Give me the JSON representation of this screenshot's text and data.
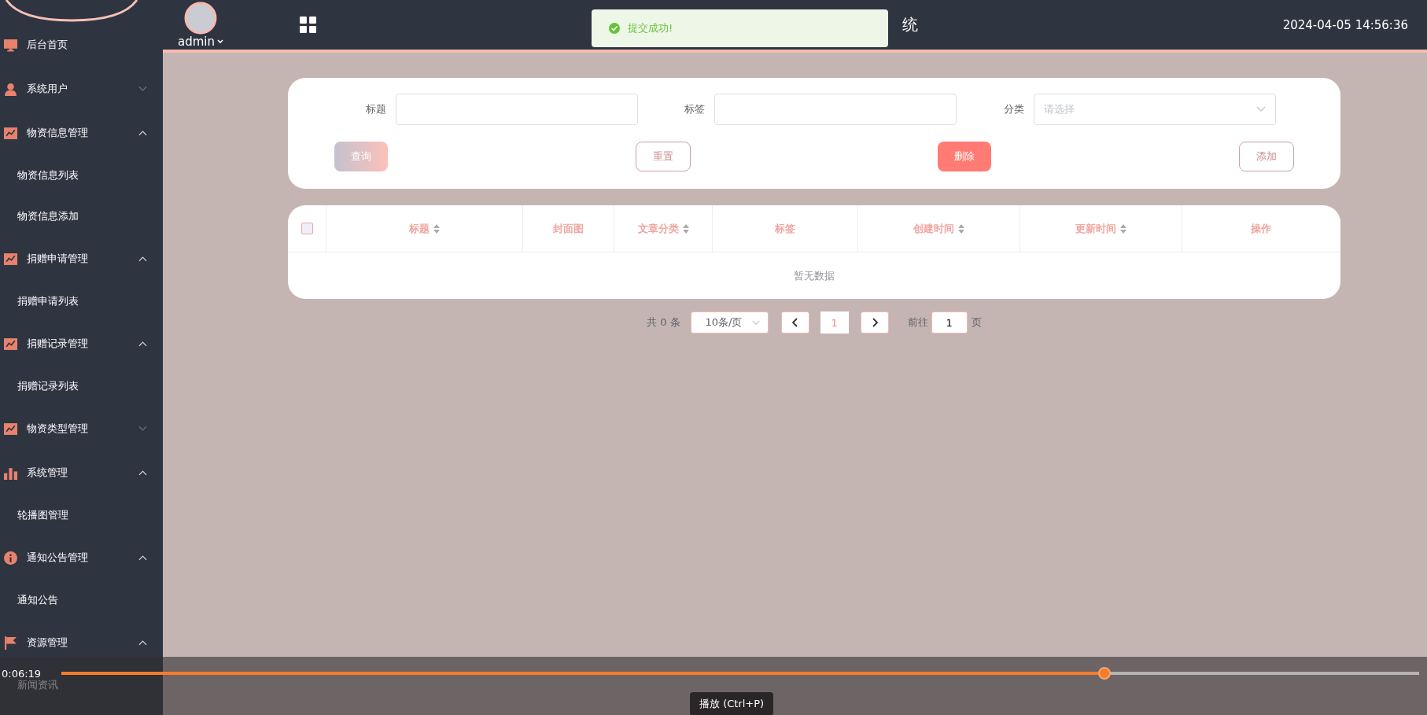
{
  "header": {
    "user": "admin",
    "title": "统",
    "datetime": "2024-04-05 14:56:36"
  },
  "toast": {
    "message": "提交成功!"
  },
  "sidebar": {
    "items": [
      {
        "kind": "link",
        "label": "后台首页"
      },
      {
        "kind": "group",
        "label": "系统用户",
        "expanded": false
      },
      {
        "kind": "group",
        "label": "物资信息管理",
        "expanded": true,
        "children": [
          {
            "label": "物资信息列表"
          },
          {
            "label": "物资信息添加"
          }
        ]
      },
      {
        "kind": "group",
        "label": "捐赠申请管理",
        "expanded": true,
        "children": [
          {
            "label": "捐赠申请列表"
          }
        ]
      },
      {
        "kind": "group",
        "label": "捐赠记录管理",
        "expanded": true,
        "children": [
          {
            "label": "捐赠记录列表"
          }
        ]
      },
      {
        "kind": "group",
        "label": "物资类型管理",
        "expanded": false
      },
      {
        "kind": "group",
        "label": "系统管理",
        "expanded": true,
        "children": [
          {
            "label": "轮播图管理"
          }
        ]
      },
      {
        "kind": "group",
        "label": "通知公告管理",
        "expanded": true,
        "children": [
          {
            "label": "通知公告"
          }
        ]
      },
      {
        "kind": "group",
        "label": "资源管理",
        "expanded": true,
        "children": [
          {
            "label": "新闻资讯"
          }
        ]
      }
    ]
  },
  "search": {
    "fields": [
      {
        "kind": "input",
        "label": "标题"
      },
      {
        "kind": "input",
        "label": "标签"
      },
      {
        "kind": "select",
        "label": "分类",
        "placeholder": "请选择"
      }
    ],
    "buttons": [
      {
        "kind": "gradient",
        "label": "查询"
      },
      {
        "kind": "outline",
        "label": "重置"
      },
      {
        "kind": "danger",
        "label": "删除"
      },
      {
        "kind": "outline",
        "label": "添加"
      }
    ]
  },
  "table": {
    "columns": [
      {
        "label": "标题",
        "sortable": true
      },
      {
        "label": "封面图",
        "sortable": false
      },
      {
        "label": "文章分类",
        "sortable": true
      },
      {
        "label": "标签",
        "sortable": false
      },
      {
        "label": "创建时间",
        "sortable": true
      },
      {
        "label": "更新时间",
        "sortable": true
      },
      {
        "label": "操作",
        "sortable": false
      }
    ],
    "select_all": {
      "checked": false
    },
    "empty_text": "暂无数据"
  },
  "pagination": {
    "total": "共 0 条",
    "page_size": "10条/页",
    "pages": [
      {
        "label": "1",
        "selected": true
      }
    ],
    "goto_label": "前往",
    "goto_value": "1",
    "goto_suffix": "页"
  },
  "player": {
    "time": "0:06:19",
    "level": 0.768,
    "tooltip": "播放 (Ctrl+P)"
  }
}
